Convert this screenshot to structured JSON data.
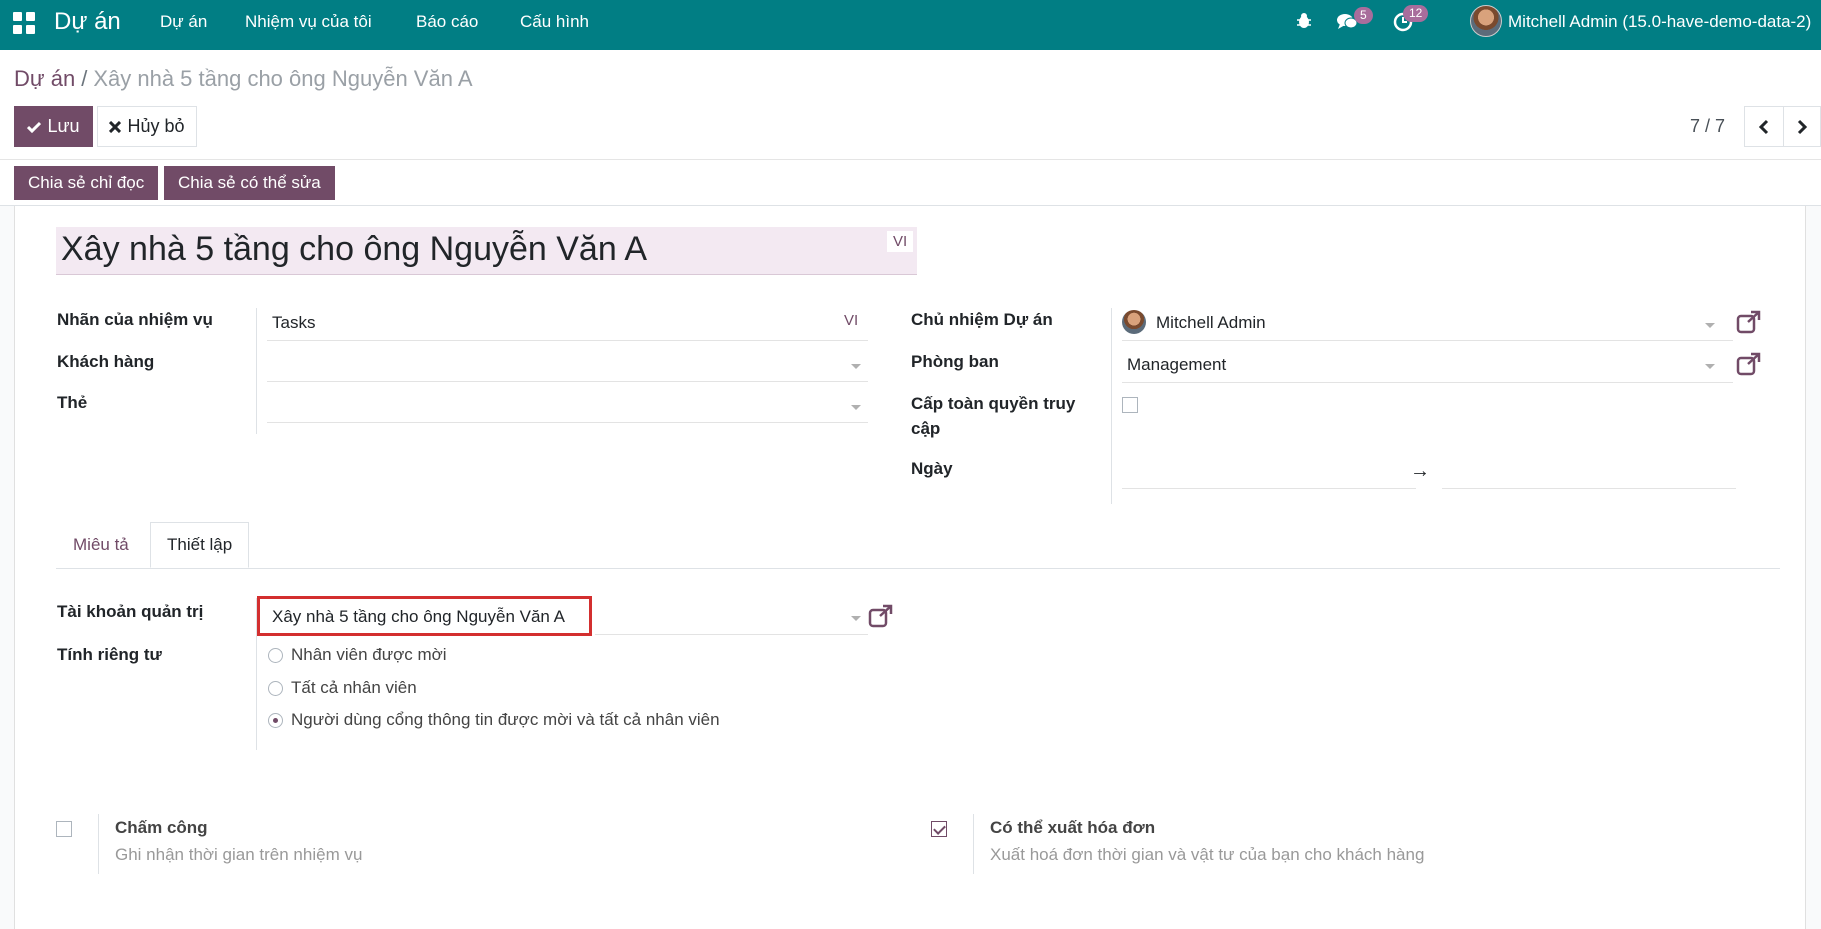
{
  "navbar": {
    "brand": "Dự án",
    "menu": [
      "Dự án",
      "Nhiệm vụ của tôi",
      "Báo cáo",
      "Cấu hình"
    ],
    "messages_count": "5",
    "activities_count": "12",
    "user": "Mitchell Admin (15.0-have-demo-data-2)"
  },
  "breadcrumb": {
    "parent": "Dự án",
    "separator": "/",
    "current": "Xây nhà 5 tầng cho ông Nguyễn Văn A"
  },
  "toolbar": {
    "save_label": "Lưu",
    "discard_label": "Hủy bỏ",
    "pager": "7 / 7"
  },
  "statusbar": {
    "share_readonly": "Chia sẻ chỉ đọc",
    "share_editable": "Chia sẻ có thể sửa"
  },
  "form": {
    "name": "Xây nhà 5 tầng cho ông Nguyễn Văn A",
    "lang": "VI",
    "left": {
      "task_label_label": "Nhãn của nhiệm vụ",
      "task_label_value": "Tasks",
      "customer_label": "Khách hàng",
      "customer_value": "",
      "tags_label": "Thẻ",
      "tags_value": ""
    },
    "right": {
      "manager_label": "Chủ nhiệm Dự án",
      "manager_value": "Mitchell Admin",
      "department_label": "Phòng ban",
      "department_value": "Management",
      "full_access_label_line1": "Cấp toàn quyền truy",
      "full_access_label_line2": "cập",
      "full_access_checked": false,
      "date_label": "Ngày",
      "date_arrow": "→"
    }
  },
  "tabs": [
    {
      "label": "Miêu tả",
      "active": false
    },
    {
      "label": "Thiết lập",
      "active": true
    }
  ],
  "settings": {
    "analytic_label": "Tài khoản quản trị",
    "analytic_value": "Xây nhà 5 tầng cho ông Nguyễn Văn A",
    "privacy_label": "Tính riêng tư",
    "privacy_options": [
      {
        "label": "Nhân viên được mời",
        "checked": false
      },
      {
        "label": "Tất cả nhân viên",
        "checked": false
      },
      {
        "label": "Người dùng cổng thông tin được mời và tất cả nhân viên",
        "checked": true
      }
    ],
    "timesheets": {
      "title": "Chấm công",
      "desc": "Ghi nhận thời gian trên nhiệm vụ",
      "checked": false
    },
    "billable": {
      "title": "Có thể xuất hóa đơn",
      "desc": "Xuất hoá đơn thời gian và vật tư của bạn cho khách hàng",
      "checked": true
    }
  },
  "colors": {
    "navbar": "#017e84",
    "primary": "#714b67",
    "highlight": "#d32f2f"
  }
}
